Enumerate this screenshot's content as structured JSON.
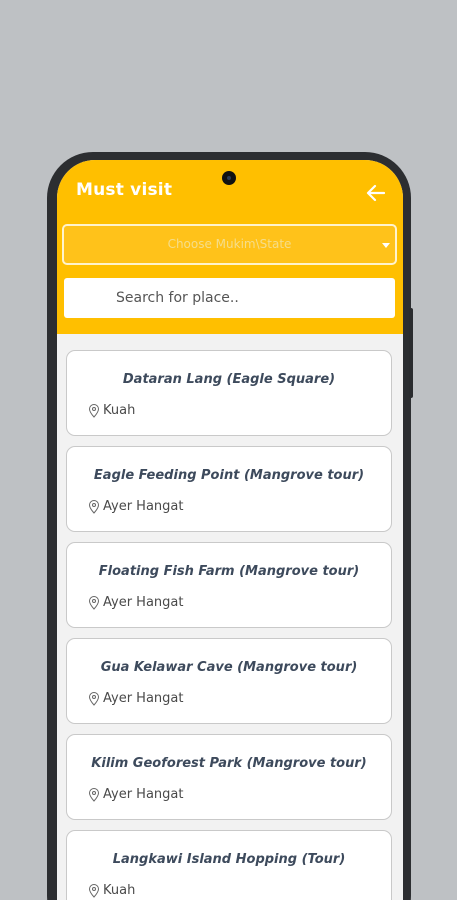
{
  "header": {
    "title": "Must visit",
    "back_icon": "arrow-left-icon",
    "color": "#ffbf00"
  },
  "filter": {
    "select_placeholder": "Choose Mukim\\State"
  },
  "search": {
    "placeholder": "Search for place.."
  },
  "places": [
    {
      "name": "Dataran Lang (Eagle Square)",
      "location": "Kuah"
    },
    {
      "name": "Eagle Feeding Point (Mangrove tour)",
      "location": "Ayer Hangat"
    },
    {
      "name": "Floating Fish Farm (Mangrove tour)",
      "location": "Ayer Hangat"
    },
    {
      "name": "Gua Kelawar Cave (Mangrove tour)",
      "location": "Ayer Hangat"
    },
    {
      "name": "Kilim Geoforest Park (Mangrove tour)",
      "location": "Ayer Hangat"
    },
    {
      "name": "Langkawi Island Hopping (Tour)",
      "location": "Kuah"
    }
  ]
}
